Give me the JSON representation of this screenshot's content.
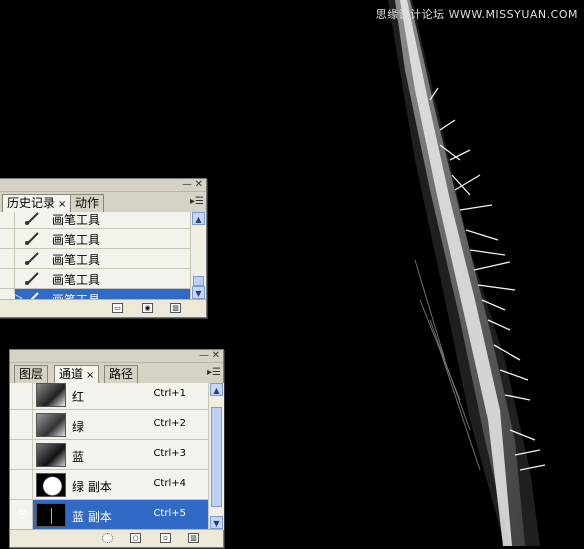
{
  "watermark": "思缘设计论坛 WWW.MISSYUAN.COM",
  "history_panel": {
    "tabs": [
      {
        "label": "历史记录",
        "close": "×"
      },
      {
        "label": "动作"
      }
    ],
    "items": [
      {
        "label": "画笔工具",
        "selected": false
      },
      {
        "label": "画笔工具",
        "selected": false
      },
      {
        "label": "画笔工具",
        "selected": false
      },
      {
        "label": "画笔工具",
        "selected": false
      },
      {
        "label": "画笔工具",
        "selected": true
      }
    ],
    "footer_icons": [
      "new-document-from-state-icon",
      "snapshot-icon",
      "trash-icon"
    ]
  },
  "channels_panel": {
    "tabs": [
      {
        "label": "图层"
      },
      {
        "label": "通道",
        "close": "×"
      },
      {
        "label": "路径"
      }
    ],
    "channels": [
      {
        "name": "红",
        "shortcut": "Ctrl+1",
        "visible": false,
        "selected": false,
        "thumb": "gray"
      },
      {
        "name": "绿",
        "shortcut": "Ctrl+2",
        "visible": false,
        "selected": false,
        "thumb": "gray"
      },
      {
        "name": "蓝",
        "shortcut": "Ctrl+3",
        "visible": false,
        "selected": false,
        "thumb": "gray"
      },
      {
        "name": "绿 副本",
        "shortcut": "Ctrl+4",
        "visible": false,
        "selected": false,
        "thumb": "mask-white"
      },
      {
        "name": "蓝 副本",
        "shortcut": "Ctrl+5",
        "visible": true,
        "selected": true,
        "thumb": "mask-dark"
      }
    ],
    "footer_icons": [
      "load-selection-icon",
      "save-selection-icon",
      "new-channel-icon",
      "trash-icon"
    ]
  },
  "colors": {
    "selection": "#3169c6",
    "panel_bg": "#ece9d8",
    "canvas_bg": "#000000"
  }
}
